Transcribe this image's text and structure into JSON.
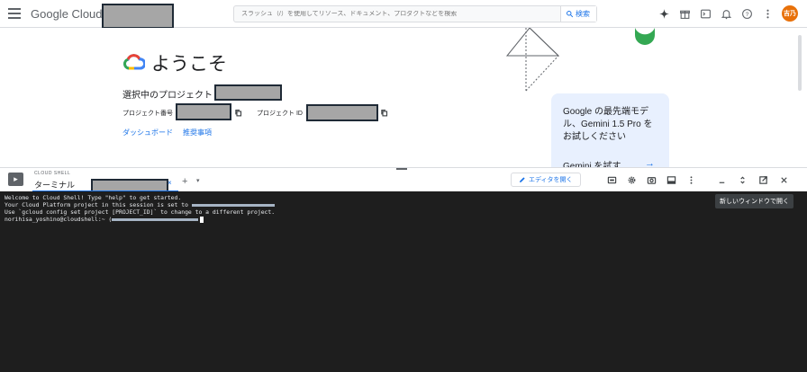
{
  "header": {
    "logo_google": "Google",
    "logo_cloud": "Cloud",
    "search_placeholder": "スラッシュ（/）を使用してリソース、ドキュメント、プロダクトなどを検索",
    "search_button": "検索",
    "avatar_text": "吉乃",
    "colors": {
      "brand_blue": "#1a73e8",
      "avatar": "#e8710a"
    }
  },
  "welcome": {
    "title": "ようこそ",
    "selected_project_label": "選択中のプロジェクト",
    "project_number_label": "プロジェクト番号",
    "project_id_label": "プロジェクト ID",
    "dashboard_link": "ダッシュボード",
    "recommend_link": "推奨事項"
  },
  "gemini_card": {
    "text": "Google の最先端モデル、Gemini 1.5 Pro をお試しください",
    "try_label": "Gemini を試す",
    "arrow": "→"
  },
  "shell": {
    "section_label": "CLOUD SHELL",
    "tab_title": "ターミナル",
    "tab_close": "×",
    "tab_add": "+",
    "tab_more": "▾",
    "editor_button": "エディタを開く",
    "tooltip": "新しいウィンドウで開く"
  },
  "terminal": {
    "line1": "Welcome to Cloud Shell! Type \"help\" to get started.",
    "line2": "Your Cloud Platform project in this session is set to ",
    "line3": "Use `gcloud config set project [PROJECT_ID]` to change to a different project.",
    "line4_prompt": "norihisa_yoshino@cloudshell:~ ("
  }
}
